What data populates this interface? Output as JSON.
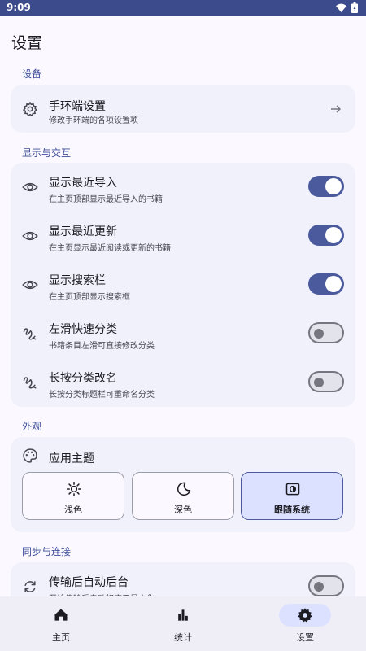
{
  "status_bar": {
    "time": "9:09"
  },
  "page_title": "设置",
  "sections": {
    "device": {
      "header": "设备",
      "band_settings": {
        "title": "手环端设置",
        "subtitle": "修改手环端的各项设置项"
      }
    },
    "display": {
      "header": "显示与交互",
      "rows": [
        {
          "title": "显示最近导入",
          "subtitle": "在主页顶部显示最近导入的书籍",
          "enabled": true
        },
        {
          "title": "显示最近更新",
          "subtitle": "在主页显示最近阅读或更新的书籍",
          "enabled": true
        },
        {
          "title": "显示搜索栏",
          "subtitle": "在主页顶部显示搜索框",
          "enabled": true
        },
        {
          "title": "左滑快速分类",
          "subtitle": "书籍条目左滑可直接修改分类",
          "enabled": false
        },
        {
          "title": "长按分类改名",
          "subtitle": "长按分类标题栏可重命名分类",
          "enabled": false
        }
      ]
    },
    "appearance": {
      "header": "外观",
      "theme_title": "应用主题",
      "options": [
        {
          "label": "浅色",
          "selected": false
        },
        {
          "label": "深色",
          "selected": false
        },
        {
          "label": "跟随系统",
          "selected": true
        }
      ]
    },
    "sync": {
      "header": "同步与连接",
      "auto_background": {
        "title": "传输后自动后台",
        "subtitle": "开始传输后自动将应用最小化",
        "enabled": false
      }
    }
  },
  "nav": {
    "items": [
      {
        "label": "主页",
        "icon": "home-icon",
        "active": false
      },
      {
        "label": "统计",
        "icon": "bar-chart-icon",
        "active": false
      },
      {
        "label": "设置",
        "icon": "gear-icon",
        "active": true
      }
    ]
  },
  "colors": {
    "accent": "#4a5a9c",
    "status_bar": "#3c4b8c",
    "card": "#f1f1fb",
    "selected": "#dce1ff"
  }
}
